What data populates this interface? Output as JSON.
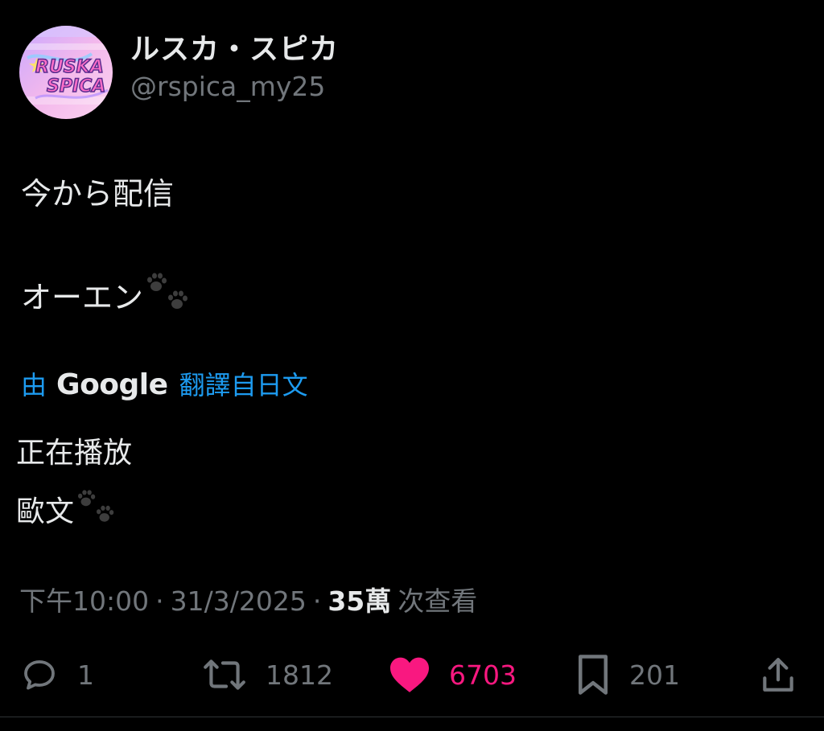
{
  "author": {
    "display_name": "ルスカ・スピカ",
    "handle": "@rspica_my25",
    "avatar_text_line1": "RUSKA",
    "avatar_text_line2": "SPICA"
  },
  "tweet": {
    "line1": "今から配信",
    "line2": "オーエン",
    "line2_emoji": "paw-prints-icon"
  },
  "translation": {
    "by_label": "由",
    "provider": "Google",
    "from_label": "翻譯自日文",
    "line1": "正在播放",
    "line2": "歐文",
    "line2_emoji": "paw-prints-icon"
  },
  "meta": {
    "time": "下午10:00",
    "separator": "·",
    "date": "31/3/2025",
    "views_count": "35萬",
    "views_label": "次查看"
  },
  "actions": {
    "reply_count": "1",
    "repost_count": "1812",
    "like_count": "6703",
    "bookmark_count": "201",
    "share_icon": "share-icon"
  },
  "colors": {
    "background": "#000000",
    "text_primary": "#e7e9ea",
    "text_secondary": "#71767b",
    "link_blue": "#1d9bf0",
    "like_pink": "#f91880"
  }
}
